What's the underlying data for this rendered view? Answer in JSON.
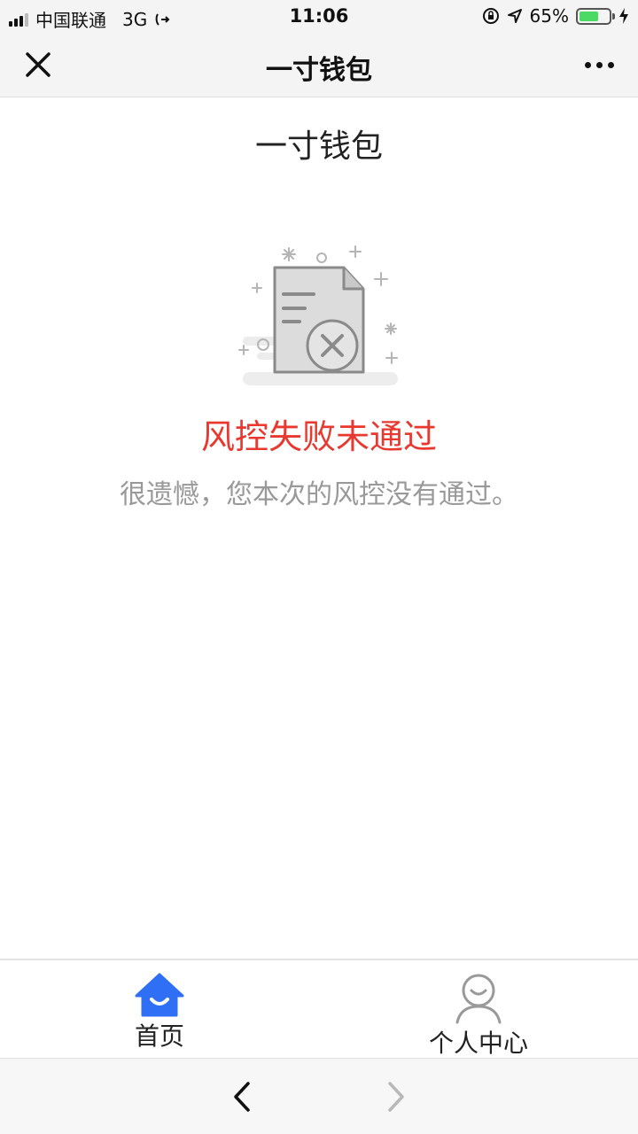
{
  "status_bar": {
    "carrier": "中国联通",
    "network": "3G",
    "time": "11:06",
    "battery_percent": "65%",
    "battery_level": 0.65,
    "battery_color": "#4cd964"
  },
  "nav": {
    "title": "一寸钱包",
    "close_icon": "close-icon",
    "more_icon": "more-icon"
  },
  "main": {
    "heading": "一寸钱包",
    "illustration_icon": "document-error-icon",
    "fail_title": "风控失败未通过",
    "fail_desc": "很遗憾，您本次的风控没有通过。",
    "fail_color": "#e8382f"
  },
  "tabbar": {
    "items": [
      {
        "label": "首页",
        "icon": "home-icon",
        "active": true,
        "color": "#2f6ff5"
      },
      {
        "label": "个人中心",
        "icon": "user-icon",
        "active": false,
        "color": "#999999"
      }
    ]
  },
  "browser_bar": {
    "back_icon": "chevron-left-icon",
    "forward_icon": "chevron-right-icon"
  }
}
